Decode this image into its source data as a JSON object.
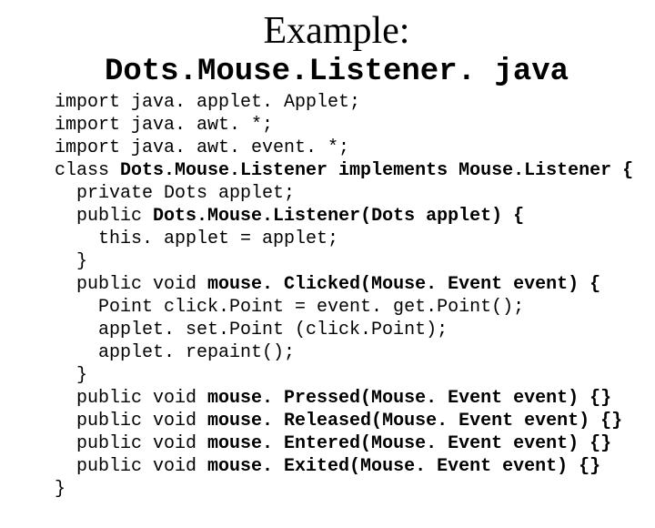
{
  "title": "Example:",
  "subtitle": "Dots.Mouse.Listener. java",
  "code": {
    "l1a": "import java. applet. Applet;",
    "l2a": "import java. awt. *;",
    "l3a": "import java. awt. event. *;",
    "l4a": "class ",
    "l4b": "Dots.Mouse.Listener implements Mouse.Listener {",
    "l5a": "  private Dots applet;",
    "l6a": "  public ",
    "l6b": "Dots.Mouse.Listener(Dots applet) {",
    "l7a": "    this. applet = applet;",
    "l8a": "  }",
    "l9a": "  public void ",
    "l9b": "mouse. Clicked(Mouse. Event event) {",
    "l10a": "    Point click.Point = event. get.Point();",
    "l11a": "    applet. set.Point (click.Point);",
    "l12a": "    applet. repaint();",
    "l13a": "  }",
    "l14a": "  public void ",
    "l14b": "mouse. Pressed(Mouse. Event event) {}",
    "l15a": "  public void ",
    "l15b": "mouse. Released(Mouse. Event event) {}",
    "l16a": "  public void ",
    "l16b": "mouse. Entered(Mouse. Event event) {}",
    "l17a": "  public void ",
    "l17b": "mouse. Exited(Mouse. Event event) {}",
    "l18a": "}"
  }
}
